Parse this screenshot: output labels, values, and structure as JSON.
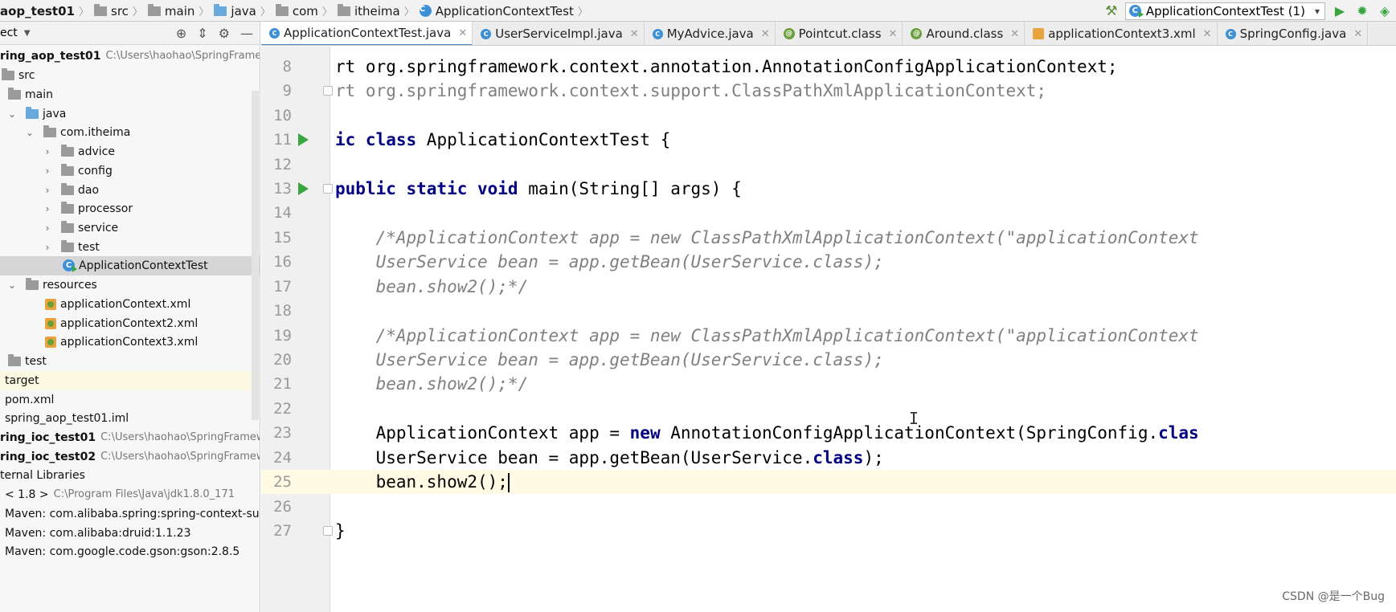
{
  "breadcrumb": [
    "aop_test01",
    "src",
    "main",
    "java",
    "com",
    "itheima",
    "ApplicationContextTest"
  ],
  "run_config": {
    "label": "ApplicationContextTest (1)"
  },
  "project_panel": {
    "title": "ect",
    "tree": [
      {
        "label": "ring_aop_test01",
        "path": "C:\\Users\\haohao\\SpringFramew",
        "bold": true
      },
      {
        "label": "src"
      },
      {
        "label": "main"
      },
      {
        "label": "java"
      },
      {
        "label": "com.itheima"
      },
      {
        "label": "advice"
      },
      {
        "label": "config"
      },
      {
        "label": "dao"
      },
      {
        "label": "processor"
      },
      {
        "label": "service"
      },
      {
        "label": "test"
      },
      {
        "label": "ApplicationContextTest"
      },
      {
        "label": "resources"
      },
      {
        "label": "applicationContext.xml"
      },
      {
        "label": "applicationContext2.xml"
      },
      {
        "label": "applicationContext3.xml"
      },
      {
        "label": "test"
      },
      {
        "label": "target"
      },
      {
        "label": "pom.xml"
      },
      {
        "label": "spring_aop_test01.iml"
      },
      {
        "label": "ring_ioc_test01",
        "path": "C:\\Users\\haohao\\SpringFramewo",
        "bold": true
      },
      {
        "label": "ring_ioc_test02",
        "path": "C:\\Users\\haohao\\SpringFramewo",
        "bold": true
      },
      {
        "label": "ternal Libraries"
      },
      {
        "label": "< 1.8 >",
        "path": "C:\\Program Files\\Java\\jdk1.8.0_171"
      },
      {
        "label": "Maven: com.alibaba.spring:spring-context-suppo"
      },
      {
        "label": "Maven: com.alibaba:druid:1.1.23"
      },
      {
        "label": "Maven: com.google.code.gson:gson:2.8.5"
      }
    ]
  },
  "tabs": [
    {
      "label": "ApplicationContextTest.java",
      "icon": "class-icon",
      "active": true
    },
    {
      "label": "UserServiceImpl.java",
      "icon": "class-icon"
    },
    {
      "label": "MyAdvice.java",
      "icon": "class-icon"
    },
    {
      "label": "Pointcut.class",
      "icon": "annotation-icon"
    },
    {
      "label": "Around.class",
      "icon": "annotation-icon"
    },
    {
      "label": "applicationContext3.xml",
      "icon": "xml-icon"
    },
    {
      "label": "SpringConfig.java",
      "icon": "class-icon"
    }
  ],
  "editor": {
    "line_numbers": [
      "8",
      "9",
      "10",
      "11",
      "12",
      "13",
      "14",
      "15",
      "16",
      "17",
      "18",
      "19",
      "20",
      "21",
      "22",
      "23",
      "24",
      "25",
      "26",
      "27"
    ],
    "lines": [
      "rt org.springframework.context.annotation.AnnotationConfigApplicationContext;",
      "rt org.springframework.context.support.ClassPathXmlApplicationContext;",
      "",
      "ic class ApplicationContextTest {",
      "",
      "public static void main(String[] args) {",
      "",
      "    /*ApplicationContext app = new ClassPathXmlApplicationContext(\"applicationContext",
      "    UserService bean = app.getBean(UserService.class);",
      "    bean.show2();*/",
      "",
      "    /*ApplicationContext app = new ClassPathXmlApplicationContext(\"applicationContext",
      "    UserService bean = app.getBean(UserService.class);",
      "    bean.show2();*/",
      "",
      "    ApplicationContext app = new AnnotationConfigApplicationContext(SpringConfig.clas",
      "    UserService bean = app.getBean(UserService.class);",
      "    bean.show2();",
      "",
      "}"
    ]
  },
  "watermark": "CSDN @是一个Bug"
}
